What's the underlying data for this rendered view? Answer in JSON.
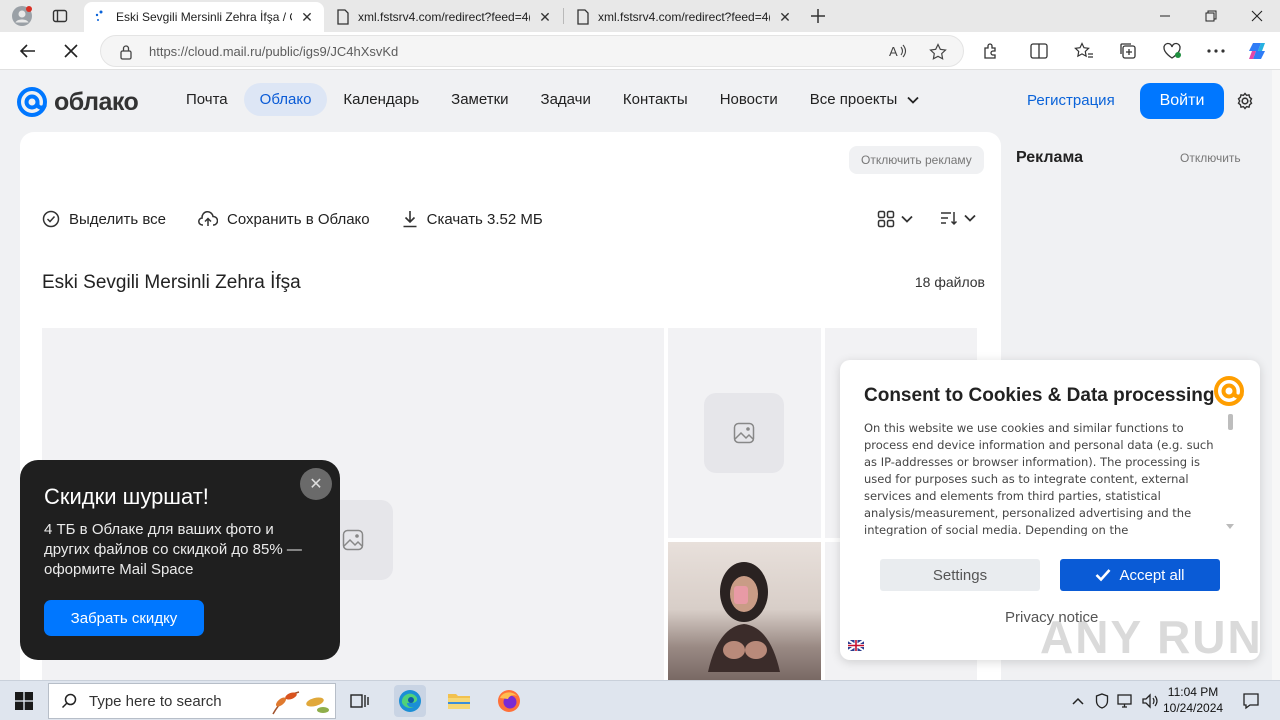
{
  "browser": {
    "tabs": [
      {
        "title": "Eski Sevgili Mersinli Zehra İfşa / О",
        "active": true
      },
      {
        "title": "xml.fstsrv4.com/redirect?feed=4(",
        "active": false
      },
      {
        "title": "xml.fstsrv4.com/redirect?feed=4(",
        "active": false
      }
    ],
    "url": "https://cloud.mail.ru/public/igs9/JC4hXsvKd"
  },
  "site": {
    "logo_text": "облако",
    "nav": [
      "Почта",
      "Облако",
      "Календарь",
      "Заметки",
      "Задачи",
      "Контакты",
      "Новости",
      "Все проекты"
    ],
    "register": "Регистрация",
    "login": "Войти"
  },
  "content": {
    "ad_off": "Отключить рекламу",
    "select_all": "Выделить все",
    "save_cloud": "Сохранить в Облако",
    "download": "Скачать 3.52 МБ",
    "folder_title": "Eski Sevgili Mersinli Zehra İfşa",
    "file_count": "18 файлов"
  },
  "sidebar": {
    "title": "Реклама",
    "off": "Отключить"
  },
  "promo": {
    "title": "Скидки шуршат!",
    "body": "4 ТБ в Облаке для ваших фото и других файлов со скидкой до 85% — оформите Mail Space",
    "button": "Забрать скидку"
  },
  "consent": {
    "title": "Consent to Cookies & Data processing",
    "body": "On this website we use cookies and similar functions to process end device information and personal data (e.g. such as IP-addresses or browser information). The processing is used for purposes such as to integrate content, external services and elements from third parties, statistical analysis/measurement, personalized advertising and the integration of social media. Depending on the",
    "settings": "Settings",
    "accept": "Accept all",
    "privacy": "Privacy notice"
  },
  "watermark": "ANY RUN",
  "taskbar": {
    "search_placeholder": "Type here to search",
    "time": "11:04 PM",
    "date": "10/24/2024"
  },
  "colors": {
    "accent": "#0077ff",
    "accept": "#0a5bd6",
    "promo_bg": "#1f1f1f"
  }
}
